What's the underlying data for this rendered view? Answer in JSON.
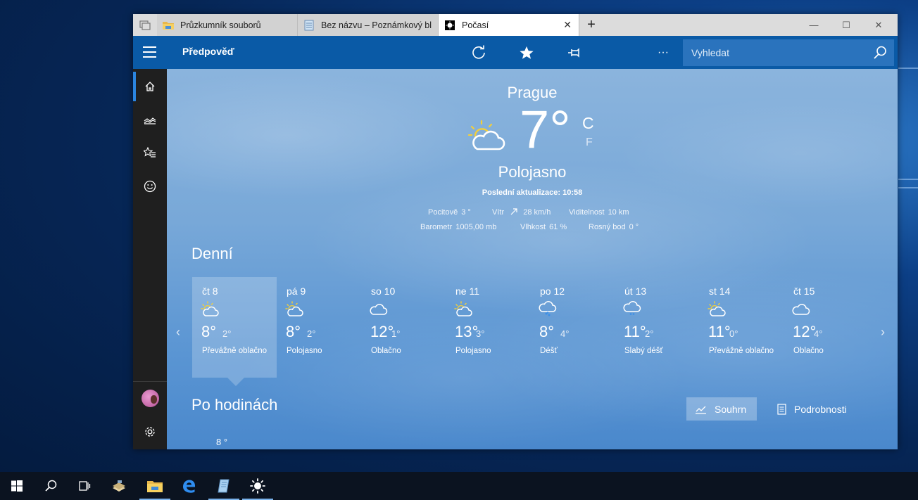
{
  "window": {
    "tabs": [
      {
        "label": "Průzkumník souborů",
        "icon": "folder-icon"
      },
      {
        "label": "Bez názvu – Poznámkový bl",
        "icon": "notepad-icon"
      },
      {
        "label": "Počasí",
        "icon": "weather-app-icon"
      }
    ],
    "close_tab_glyph": "✕",
    "new_tab_glyph": "+",
    "controls": {
      "minimize": "—",
      "maximize": "☐",
      "close": "✕"
    }
  },
  "appbar": {
    "title": "Předpověď",
    "icons": [
      "refresh-icon",
      "favorite-star-icon",
      "pin-icon",
      "dark-mode-icon",
      "more-icon"
    ],
    "more_glyph": "···",
    "search_placeholder": "Vyhledat"
  },
  "sidebar": {
    "items": [
      "home-icon",
      "historical-chart-icon",
      "favorites-icon",
      "feedback-smiley-icon"
    ],
    "bottom": [
      "avatar",
      "settings-icon"
    ]
  },
  "current": {
    "city": "Prague",
    "temperature": "7°",
    "unit_c": "C",
    "unit_f": "F",
    "condition": "Polojasno",
    "updated": "Poslední aktualizace: 10:58",
    "feels_like": {
      "label": "Pocitově",
      "value": "3 °"
    },
    "wind": {
      "label": "Vítr",
      "value": "28 km/h"
    },
    "visibility": {
      "label": "Viditelnost",
      "value": "10 km"
    },
    "pressure": {
      "label": "Barometr",
      "value": "1005,00 mb"
    },
    "humidity": {
      "label": "Vlhkost",
      "value": "61 %"
    },
    "dew_point": {
      "label": "Rosný bod",
      "value": "0 °"
    }
  },
  "daily": {
    "title": "Denní",
    "days": [
      {
        "name": "čt 8",
        "hi": "8°",
        "lo": "2°",
        "condition": "Převážně oblačno",
        "icon": "partly-cloudy-icon"
      },
      {
        "name": "pá 9",
        "hi": "8°",
        "lo": "2°",
        "condition": "Polojasno",
        "icon": "partly-cloudy-icon"
      },
      {
        "name": "so 10",
        "hi": "12°",
        "lo": "1°",
        "condition": "Oblačno",
        "icon": "cloudy-icon"
      },
      {
        "name": "ne 11",
        "hi": "13°",
        "lo": "3°",
        "condition": "Polojasno",
        "icon": "partly-cloudy-icon"
      },
      {
        "name": "po 12",
        "hi": "8°",
        "lo": "4°",
        "condition": "Déšť",
        "icon": "rain-icon"
      },
      {
        "name": "út 13",
        "hi": "11°",
        "lo": "2°",
        "condition": "Slabý déšť",
        "icon": "light-rain-icon"
      },
      {
        "name": "st 14",
        "hi": "11°",
        "lo": "0°",
        "condition": "Převážně oblačno",
        "icon": "partly-cloudy-icon"
      },
      {
        "name": "čt 15",
        "hi": "12°",
        "lo": "4°",
        "condition": "Oblačno",
        "icon": "cloudy-icon"
      }
    ]
  },
  "hourly": {
    "title": "Po hodinách",
    "summary_label": "Souhrn",
    "details_label": "Podrobnosti",
    "first_temp": "8 °"
  },
  "taskbar": {
    "items": [
      "start-icon",
      "search-icon",
      "task-view-icon",
      "books-app-icon",
      "file-explorer-icon",
      "edge-browser-icon",
      "notepad-icon",
      "weather-app-icon"
    ]
  }
}
